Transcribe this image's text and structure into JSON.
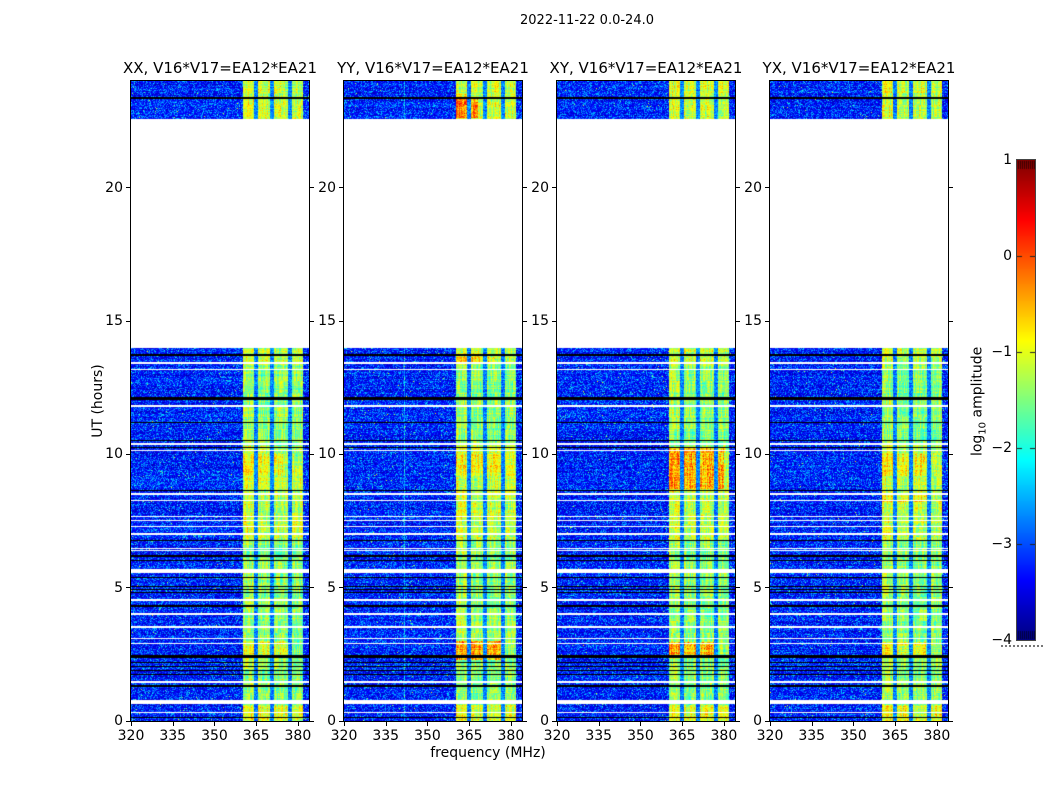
{
  "figure": {
    "title": "2022-11-22 0.0-24.0",
    "xlabel": "frequency (MHz)",
    "ylabel": "UT (hours)",
    "bg_color": "#ffffff"
  },
  "chart_data": {
    "type": "heatmap",
    "title": "2022-11-22 0.0-24.0",
    "xlabel": "frequency (MHz)",
    "ylabel": "UT (hours)",
    "colormap": "jet",
    "legend_position": "right-colorbar",
    "x_range_mhz": [
      320,
      384
    ],
    "x_tick_values": [
      320,
      335,
      350,
      365,
      380
    ],
    "x_tick_labels": [
      "320",
      "335",
      "350",
      "365",
      "380"
    ],
    "y_range_hours": [
      0,
      24
    ],
    "y_tick_values": [
      0,
      5,
      10,
      15,
      20
    ],
    "y_tick_labels": [
      "0",
      "5",
      "10",
      "15",
      "20"
    ],
    "value_range_log10": [
      -4,
      1
    ],
    "background_level": -3.45,
    "data_blocks_ut": [
      [
        0,
        13.98
      ],
      [
        22.58,
        24.0
      ]
    ],
    "empty_gap_ut": [
      13.98,
      22.58
    ],
    "rfi_band": {
      "start_mhz": 360.4,
      "end_mhz": 381.8,
      "base_level": -1.45,
      "gaps_mhz": [
        [
          364.3,
          365.7
        ],
        [
          370.0,
          371.4
        ],
        [
          376.4,
          377.9
        ]
      ]
    },
    "dropout_lines_white_ut": [
      [
        13.42,
        2
      ],
      [
        13.2,
        1
      ],
      [
        11.82,
        2
      ],
      [
        10.38,
        2
      ],
      [
        10.15,
        1
      ],
      [
        8.52,
        2
      ],
      [
        8.3,
        1
      ],
      [
        7.7,
        1
      ],
      [
        7.55,
        1
      ],
      [
        7.3,
        1
      ],
      [
        7.0,
        2
      ],
      [
        6.5,
        1
      ],
      [
        6.4,
        1
      ],
      [
        5.62,
        4
      ],
      [
        4.52,
        2
      ],
      [
        4.0,
        2
      ],
      [
        3.52,
        2
      ],
      [
        3.1,
        1
      ],
      [
        2.92,
        1
      ],
      [
        1.47,
        2
      ],
      [
        0.72,
        4
      ],
      [
        0.35,
        1
      ]
    ],
    "rfi_lines_black_ut": [
      [
        23.38,
        2
      ],
      [
        13.72,
        2
      ],
      [
        12.1,
        3
      ],
      [
        11.2,
        1
      ],
      [
        10.52,
        1
      ],
      [
        10.28,
        1
      ],
      [
        8.66,
        1
      ],
      [
        6.8,
        1
      ],
      [
        6.18,
        2
      ],
      [
        6.05,
        1
      ],
      [
        5.4,
        1
      ],
      [
        5.05,
        1
      ],
      [
        4.95,
        1
      ],
      [
        4.85,
        1
      ],
      [
        4.3,
        2
      ],
      [
        2.45,
        3
      ],
      [
        2.2,
        1
      ],
      [
        2.05,
        1
      ],
      [
        1.9,
        1
      ],
      [
        1.75,
        1
      ],
      [
        1.3,
        2
      ],
      [
        0.15,
        1
      ]
    ],
    "panels": [
      {
        "label": "XX, V16*V17=EA12*EA21",
        "pol": "XX",
        "seed": 101,
        "hotspots": [
          [
            6.8,
            10.3,
            360,
            382,
            0.25
          ],
          [
            0,
            0.6,
            360,
            382,
            0.45
          ],
          [
            22.58,
            24,
            360,
            382,
            0.3
          ],
          [
            13.35,
            13.95,
            360,
            382,
            0.3
          ],
          [
            9.3,
            10.0,
            360,
            375,
            0.25
          ],
          [
            2.35,
            3.0,
            360,
            378,
            0.45
          ]
        ]
      },
      {
        "label": "YY, V16*V17=EA12*EA21",
        "pol": "YY",
        "seed": 202,
        "faint_cols_mhz": [
          341.8
        ],
        "hotspots": [
          [
            6.8,
            10.3,
            360,
            382,
            0.25
          ],
          [
            0,
            0.6,
            360,
            382,
            0.45
          ],
          [
            22.58,
            24,
            360,
            382,
            0.3
          ],
          [
            13.35,
            13.95,
            360,
            382,
            0.3
          ],
          [
            9.3,
            10.0,
            360,
            378,
            0.3
          ],
          [
            2.3,
            3.0,
            359,
            378,
            0.95
          ],
          [
            22.6,
            23.35,
            359,
            368,
            0.8
          ],
          [
            13.4,
            13.8,
            360,
            372,
            0.4
          ]
        ]
      },
      {
        "label": "XY, V16*V17=EA12*EA21",
        "pol": "XY",
        "seed": 303,
        "hotspots": [
          [
            6.8,
            10.3,
            360,
            382,
            0.25
          ],
          [
            0,
            0.6,
            360,
            382,
            0.45
          ],
          [
            22.58,
            24,
            360,
            382,
            0.3
          ],
          [
            13.35,
            13.95,
            360,
            382,
            0.3
          ],
          [
            8.7,
            10.25,
            359,
            380,
            0.75
          ],
          [
            2.35,
            2.95,
            360,
            377,
            0.85
          ]
        ]
      },
      {
        "label": "YX, V16*V17=EA12*EA21",
        "pol": "YX",
        "seed": 404,
        "hotspots": [
          [
            6.8,
            10.3,
            360,
            382,
            0.25
          ],
          [
            0,
            0.6,
            360,
            382,
            0.45
          ],
          [
            22.58,
            24,
            360,
            382,
            0.3
          ],
          [
            13.35,
            13.95,
            360,
            382,
            0.3
          ],
          [
            9.2,
            10.0,
            360,
            378,
            0.35
          ],
          [
            2.35,
            2.95,
            360,
            376,
            0.5
          ],
          [
            8.2,
            8.5,
            360,
            378,
            0.3
          ]
        ]
      }
    ],
    "colorbar": {
      "label_prefix": "log",
      "label_sub": "10",
      "label_suffix": " amplitude",
      "tick_values": [
        1,
        0,
        -1,
        -2,
        -3,
        -4
      ],
      "tick_labels": [
        "1",
        "0",
        "−1",
        "−2",
        "−3",
        "−4"
      ],
      "top_color": "#800000",
      "bottom_color": "#000080"
    }
  }
}
